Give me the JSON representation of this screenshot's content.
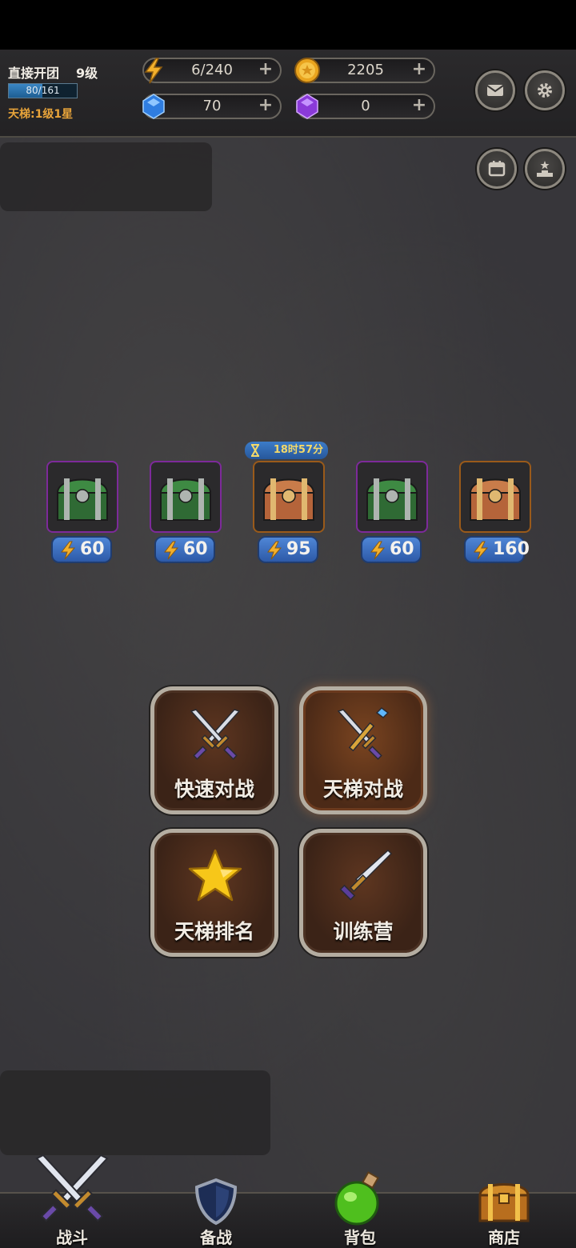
{
  "player": {
    "name": "直接开团",
    "level": "9级",
    "xp_text": "80/161",
    "xp_fraction": 0.497,
    "ladder_rank": "天梯:1级1星"
  },
  "resources": {
    "energy": {
      "value": "6/240",
      "icon": "lightning-icon"
    },
    "gold": {
      "value": "2205",
      "icon": "gold-coin-icon"
    },
    "blue_gem": {
      "value": "70",
      "icon": "blue-gem-icon"
    },
    "purple_gem": {
      "value": "0",
      "icon": "purple-gem-icon"
    },
    "plus_label": "+"
  },
  "top_buttons": [
    "mail-icon",
    "gear-icon",
    "calendar-icon",
    "podium-icon"
  ],
  "chests": {
    "timer": "18时57分",
    "slots": [
      {
        "type": "green",
        "frame": "purple",
        "cost": "60"
      },
      {
        "type": "green",
        "frame": "purple",
        "cost": "60"
      },
      {
        "type": "gold",
        "frame": "orange",
        "cost": "95"
      },
      {
        "type": "green",
        "frame": "purple",
        "cost": "60"
      },
      {
        "type": "gold",
        "frame": "orange",
        "cost": "160"
      }
    ]
  },
  "actions": {
    "quick_battle": "快速对战",
    "ladder_battle": "天梯对战",
    "ladder_ranking": "天梯排名",
    "training_camp": "训练营"
  },
  "nav": {
    "battle": "战斗",
    "prepare": "备战",
    "backpack": "背包",
    "shop": "商店"
  },
  "colors": {
    "background": "#37363a",
    "accent_orange": "#e8a43a",
    "badge_blue": "#3c7cc8",
    "purple_frame": "#7d2a9a",
    "orange_frame": "#9a5a1a"
  }
}
